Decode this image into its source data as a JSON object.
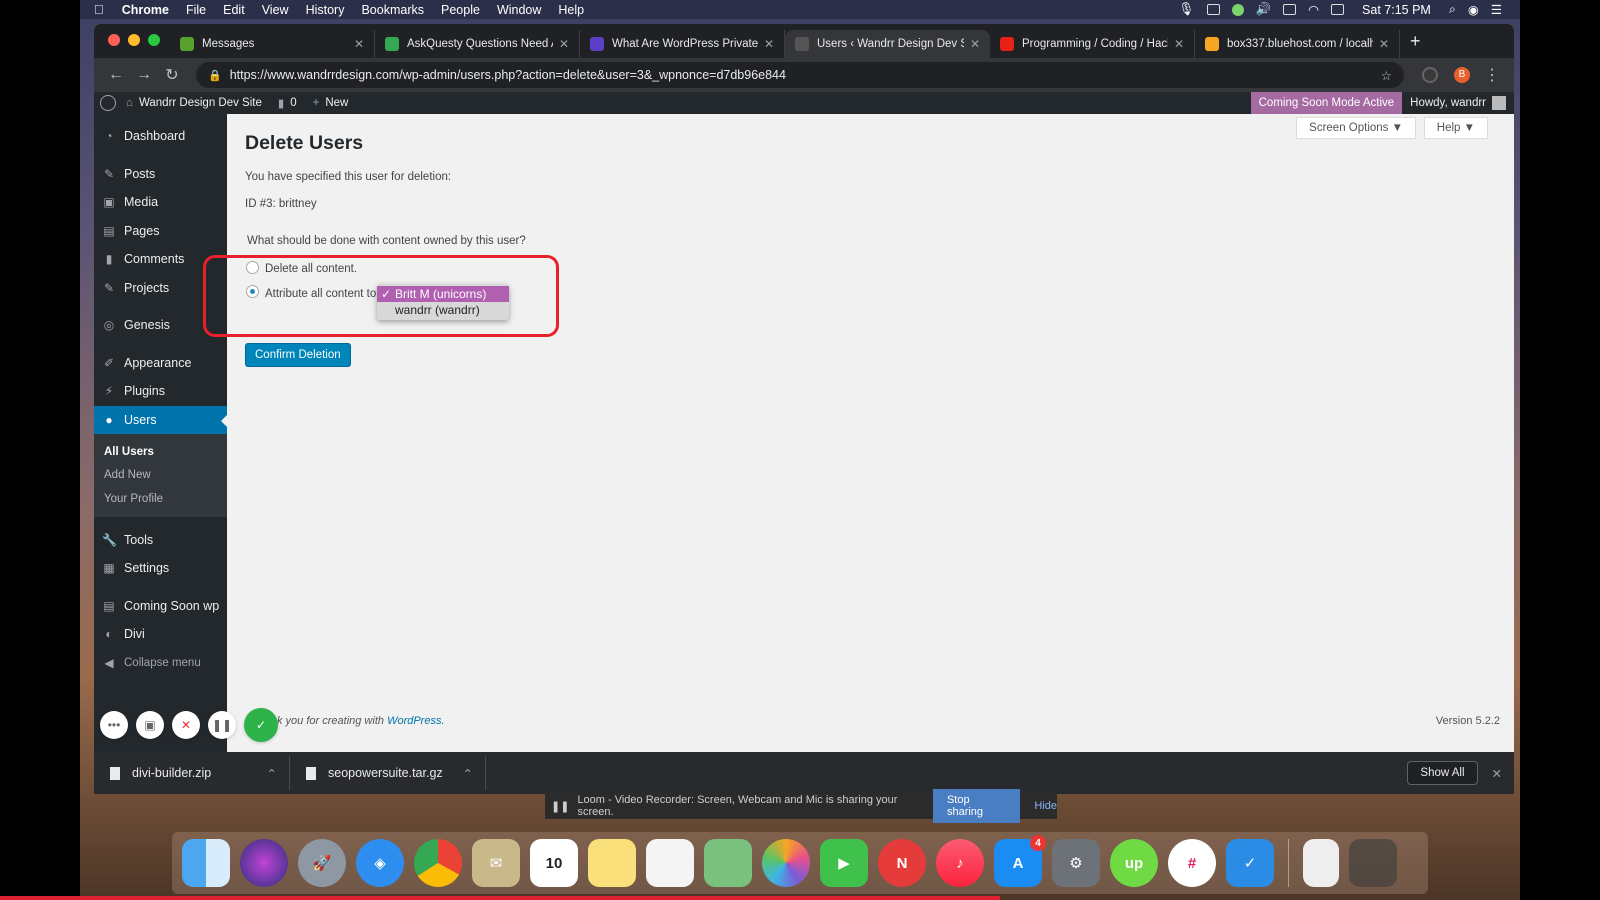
{
  "menubar": {
    "app": "Chrome",
    "items": [
      "File",
      "Edit",
      "View",
      "History",
      "Bookmarks",
      "People",
      "Window",
      "Help"
    ],
    "clock": "Sat 7:15 PM"
  },
  "tabs": [
    {
      "title": "Messages",
      "color": "#5aa02c"
    },
    {
      "title": "AskQuesty Questions Need An",
      "color": "#34a853"
    },
    {
      "title": "What Are WordPress Private P",
      "color": "#5b3fc4"
    },
    {
      "title": "Users ‹ Wandrr Design Dev Si",
      "color": "#2a2a2a"
    },
    {
      "title": "Programming / Coding / Hacki",
      "color": "#e62117"
    },
    {
      "title": "box337.bluehost.com / localho",
      "color": "#f5a623"
    }
  ],
  "url": "https://www.wandrrdesign.com/wp-admin/users.php?action=delete&user=3&_wpnonce=d7db96e844",
  "extension_letter": "B",
  "adminbar": {
    "site": "Wandrr Design Dev Site",
    "comments": "0",
    "new": "New",
    "coming_soon": "Coming Soon Mode Active",
    "howdy": "Howdy, wandrr"
  },
  "sidebar": {
    "items": [
      "Dashboard",
      "Posts",
      "Media",
      "Pages",
      "Comments",
      "Projects",
      "Genesis",
      "Appearance",
      "Plugins",
      "Users",
      "Tools",
      "Settings",
      "Coming Soon wp",
      "Divi",
      "Collapse menu"
    ],
    "submenu": [
      "All Users",
      "Add New",
      "Your Profile"
    ]
  },
  "content": {
    "screen_options": "Screen Options ▼",
    "help": "Help ▼",
    "title": "Delete Users",
    "specified": "You have specified this user for deletion:",
    "user": "ID #3: brittney",
    "question": "What should be done with content owned by this user?",
    "option_delete": "Delete all content.",
    "option_attribute": "Attribute all content to:",
    "dropdown_options": [
      "Britt M (unicorns)",
      "wandrr (wandrr)"
    ],
    "dropdown_selected": 0,
    "confirm": "Confirm Deletion",
    "footer_text": "k you for creating with",
    "footer_link": "WordPress.",
    "version": "Version 5.2.2"
  },
  "downloads": [
    {
      "name": "divi-builder.zip"
    },
    {
      "name": "seopowersuite.tar.gz"
    }
  ],
  "show_all": "Show All",
  "share_bar": {
    "text": "Loom - Video Recorder: Screen, Webcam and Mic is sharing your screen.",
    "stop": "Stop sharing",
    "hide": "Hide"
  },
  "dock": {
    "calendar_day": "10",
    "appstore_badge": "4"
  }
}
